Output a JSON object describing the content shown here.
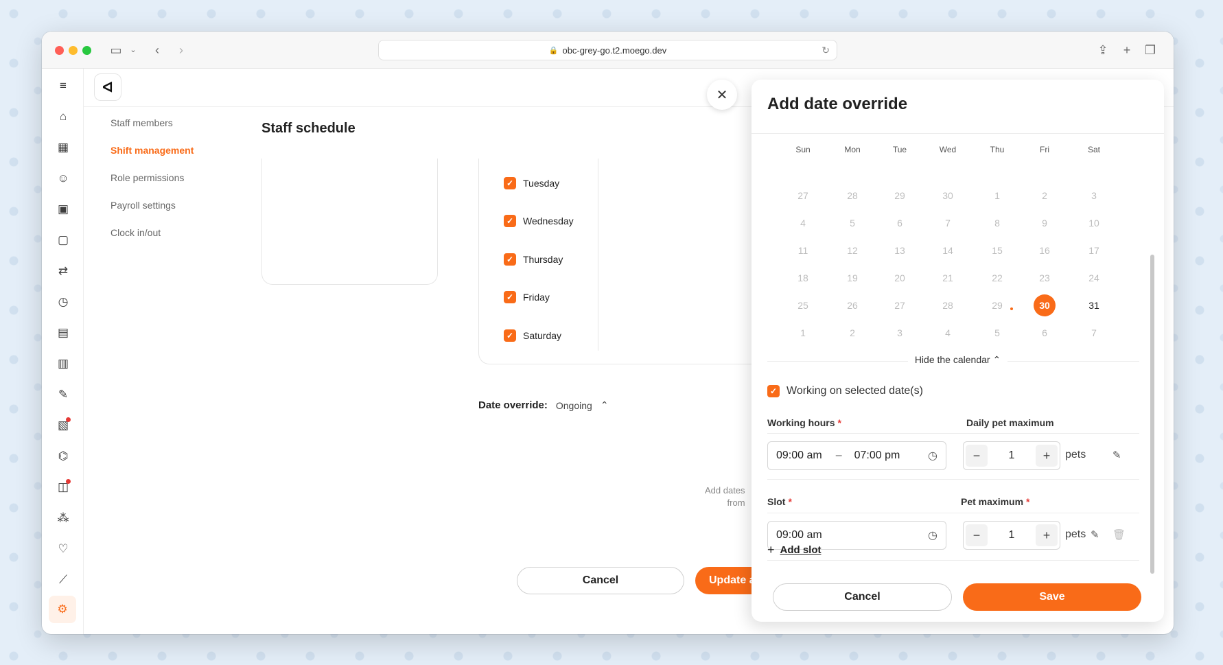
{
  "browser": {
    "url": "obc-grey-go.t2.moego.dev"
  },
  "nav": {
    "items": [
      {
        "label": "Staff members",
        "active": false
      },
      {
        "label": "Shift management",
        "active": true
      },
      {
        "label": "Role permissions",
        "active": false
      },
      {
        "label": "Payroll settings",
        "active": false
      },
      {
        "label": "Clock in/out",
        "active": false
      }
    ]
  },
  "page": {
    "title": "Staff schedule",
    "days": [
      "Tuesday",
      "Wednesday",
      "Thursday",
      "Friday",
      "Saturday"
    ],
    "date_override_label": "Date override:",
    "date_override_value": "Ongoing",
    "hint_line1": "Add dates",
    "hint_line2": "from",
    "cancel_label": "Cancel",
    "update_label": "Update a"
  },
  "drawer": {
    "title": "Add date override",
    "weekdays": [
      "Sun",
      "Mon",
      "Tue",
      "Wed",
      "Thu",
      "Fri",
      "Sat"
    ],
    "weeks": [
      [
        "27",
        "28",
        "29",
        "30",
        "1",
        "2",
        "3"
      ],
      [
        "4",
        "5",
        "6",
        "7",
        "8",
        "9",
        "10"
      ],
      [
        "11",
        "12",
        "13",
        "14",
        "15",
        "16",
        "17"
      ],
      [
        "18",
        "19",
        "20",
        "21",
        "22",
        "23",
        "24"
      ],
      [
        "25",
        "26",
        "27",
        "28",
        "29",
        "30",
        "31"
      ],
      [
        "1",
        "2",
        "3",
        "4",
        "5",
        "6",
        "7"
      ]
    ],
    "selected_day": "30",
    "hide_calendar": "Hide the calendar",
    "working_label": "Working on selected date(s)",
    "working_hours_label": "Working hours",
    "daily_pet_max_label": "Daily pet maximum",
    "start_time": "09:00 am",
    "end_time": "07:00 pm",
    "daily_pet_value": "1",
    "pets_unit": "pets",
    "slot_label": "Slot",
    "pet_max_label": "Pet maximum",
    "slot_time": "09:00 am",
    "slot_pet_value": "1",
    "add_slot": "Add slot",
    "cancel_label": "Cancel",
    "save_label": "Save"
  },
  "colors": {
    "accent": "#f96b18",
    "required": "#e53935"
  }
}
